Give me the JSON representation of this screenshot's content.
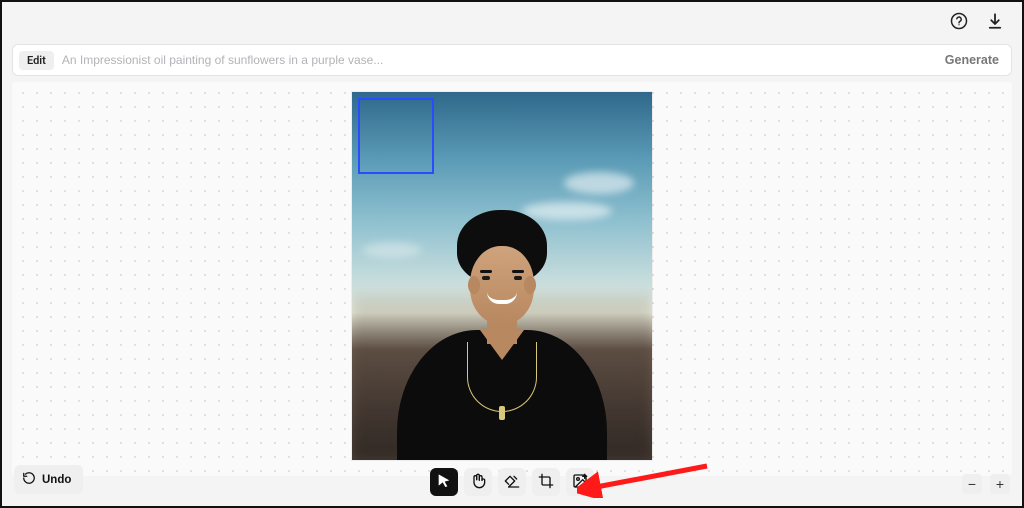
{
  "header": {
    "help_icon": "help-circle",
    "download_icon": "download"
  },
  "prompt": {
    "mode_label": "Edit",
    "placeholder": "An Impressionist oil painting of sunflowers in a purple vase...",
    "value": "",
    "generate_label": "Generate"
  },
  "undo": {
    "label": "Undo"
  },
  "toolbar": {
    "items": [
      {
        "name": "cursor-tool",
        "icon": "cursor",
        "active": true
      },
      {
        "name": "hand-tool",
        "icon": "hand",
        "active": false
      },
      {
        "name": "eraser-tool",
        "icon": "eraser",
        "active": false
      },
      {
        "name": "crop-tool",
        "icon": "crop",
        "active": false
      },
      {
        "name": "image-add-tool",
        "icon": "image-plus",
        "active": false
      }
    ]
  },
  "zoom": {
    "minus": "−",
    "plus": "+"
  },
  "selection": {
    "color": "#2a4bff"
  }
}
